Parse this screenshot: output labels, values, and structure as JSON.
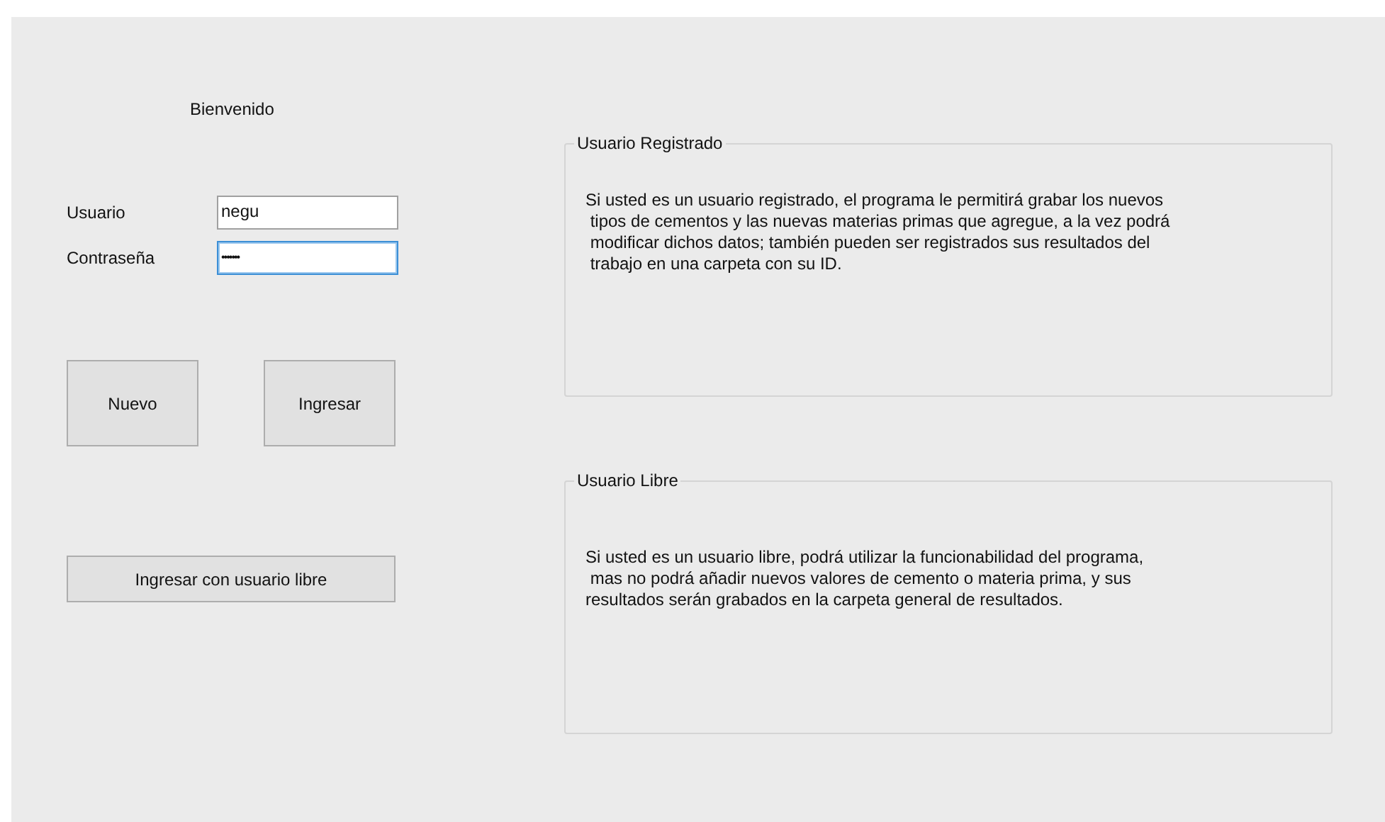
{
  "welcome": "Bienvenido",
  "fields": [
    {
      "label": "Usuario",
      "value": "negu",
      "focused": false
    },
    {
      "label": "Contraseña",
      "value": "•••••••",
      "focused": true
    }
  ],
  "buttons": [
    "Nuevo",
    "Ingresar"
  ],
  "free_button": "Ingresar con usuario libre",
  "groups": [
    {
      "title": "Usuario Registrado",
      "text": "Si usted es un usuario registrado, el programa le permitirá grabar los nuevos\n tipos de cementos y las nuevas materias primas que agregue, a la vez podrá\n modificar dichos datos; también pueden ser registrados sus resultados del\n trabajo en una carpeta con su ID."
    },
    {
      "title": "Usuario Libre",
      "text": "Si usted es un usuario libre, podrá utilizar la funcionabilidad del programa,\n mas no podrá añadir nuevos valores de cemento o materia prima, y sus\nresultados serán grabados en la carpeta general de resultados."
    }
  ]
}
